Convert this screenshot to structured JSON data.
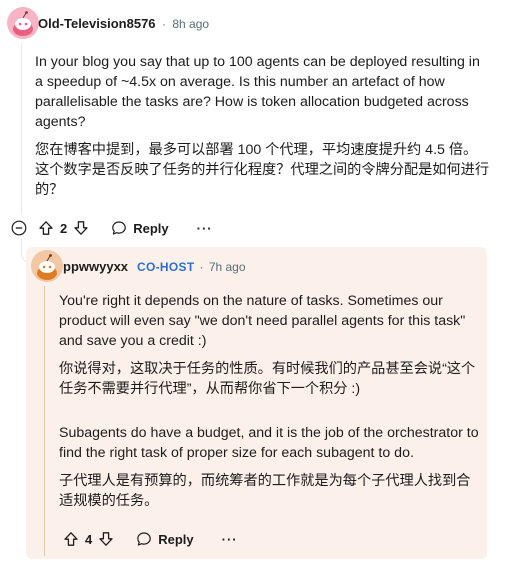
{
  "comment": {
    "author": "Old-Television8576",
    "time": "8h ago",
    "paragraph_en": "In your blog you say that up to 100 agents can be deployed resulting in a speedup of ~4.5x on average. Is this number an artefact of how parallelisable the tasks are? How is token allocation budgeted across agents?",
    "paragraph_zh": "您在博客中提到，最多可以部署 100 个代理，平均速度提升约 4.5 倍。这个数字是否反映了任务的并行化程度？代理之间的令牌分配是如何进行的？",
    "votes": "2",
    "reply_label": "Reply",
    "more_label": "···"
  },
  "reply": {
    "author": "ppwwyyxx",
    "badge": "CO-HOST",
    "time": "7h ago",
    "p1_en": "You're right it depends on the nature of tasks. Sometimes our product will even say \"we don't need parallel agents for this task\" and save you a credit :)",
    "p1_zh": "你说得对，这取决于任务的性质。有时候我们的产品甚至会说“这个任务不需要并行代理”，从而帮你省下一个积分 :)",
    "p2_en": "Subagents do have a budget, and it is the job of the orchestrator to find the right task of proper size for each subagent to do.",
    "p2_zh": "子代理人是有预算的，而统筹者的工作就是为每个子代理人找到合适规模的任务。",
    "votes": "4",
    "reply_label": "Reply",
    "more_label": "···"
  },
  "colors": {
    "reply_background": "#fbf1ea",
    "cohost_badge": "#2b6fd1",
    "meta_text": "#576f76"
  },
  "icons": {
    "avatar_1": "reddit-snoo-avatar-pink",
    "avatar_2": "reddit-snoo-avatar-orange",
    "upvote": "arrow-up-icon",
    "downvote": "arrow-down-icon",
    "collapse": "minus-circle-icon",
    "reply": "speech-bubble-icon"
  }
}
